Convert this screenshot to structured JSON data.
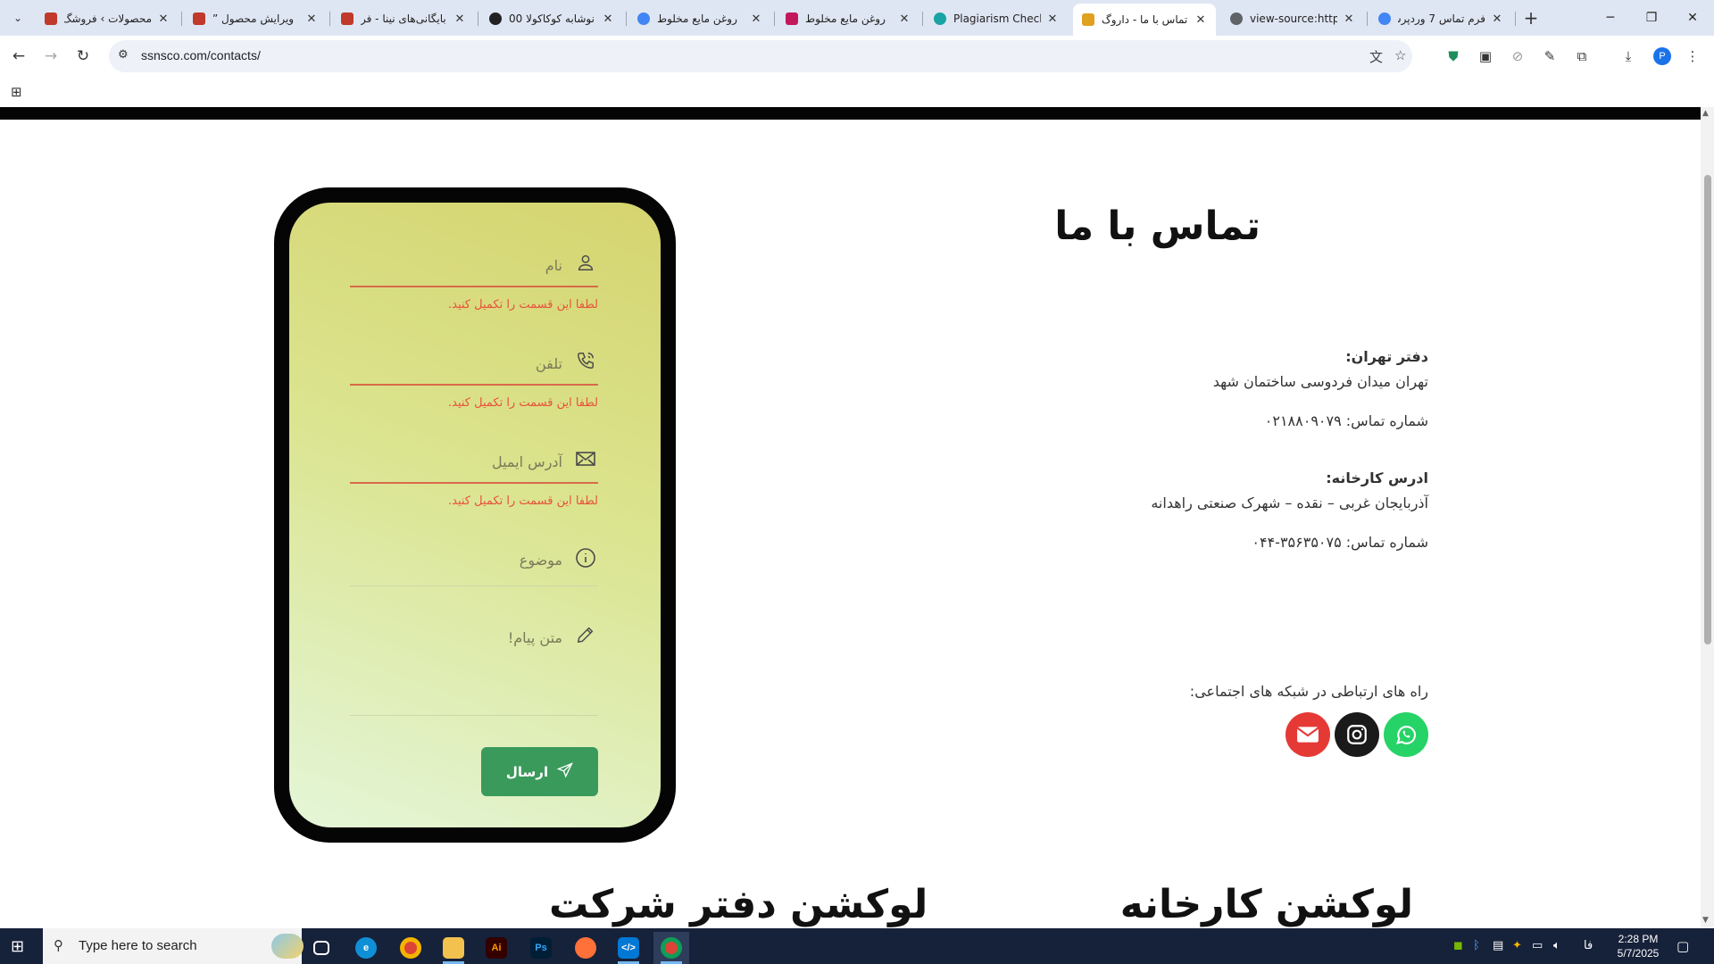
{
  "browser": {
    "tabs": [
      {
        "title": "محصولات › فروشگ",
        "favicon_color": "#c0392b",
        "active": false
      },
      {
        "title": "ویرایش محصول ”",
        "favicon_color": "#c0392b",
        "active": false
      },
      {
        "title": "بایگانی‌های نینا - فر",
        "favicon_color": "#c0392b",
        "active": false
      },
      {
        "title": "نوشابه کوکاکولا 00",
        "favicon_color": "#222222",
        "active": false
      },
      {
        "title": "روغن مایع مخلوط",
        "favicon_color": "#4285f4",
        "active": false
      },
      {
        "title": "روغن مایع مخلوط",
        "favicon_color": "#c2185b",
        "active": false
      },
      {
        "title": "Plagiarism Checke",
        "favicon_color": "#1aa3a3",
        "active": false
      },
      {
        "title": "تماس با ما - داروگ",
        "favicon_color": "#e0a020",
        "active": true
      },
      {
        "title": "view-source:https",
        "favicon_color": "#5f6368",
        "active": false
      },
      {
        "title": "فرم تماس 7 وردپرس",
        "favicon_color": "#4285f4",
        "active": false
      }
    ],
    "url": "ssnsco.com/contacts/",
    "profile_initial": "P"
  },
  "page": {
    "title": "تماس با ما",
    "form": {
      "fields": [
        {
          "placeholder": "نام",
          "icon": "user-icon",
          "error": "لطفا این قسمت را تکمیل کنید."
        },
        {
          "placeholder": "تلفن",
          "icon": "phone-icon",
          "error": "لطفا این قسمت را تکمیل کنید."
        },
        {
          "placeholder": "آدرس ایمیل",
          "icon": "envelope-icon",
          "error": "لطفا این قسمت را تکمیل کنید."
        },
        {
          "placeholder": "موضوع",
          "icon": "info-icon",
          "error": ""
        },
        {
          "placeholder": "متن پیام!",
          "icon": "pencil-icon",
          "error": ""
        }
      ],
      "submit_label": "ارسال"
    },
    "offices": [
      {
        "label": "دفتر تهران:",
        "address": "تهران میدان فردوسی ساختمان شهد",
        "phone": "شماره تماس: ۰۲۱۸۸۰۹۰۷۹"
      },
      {
        "label": "ادرس کارخانه:",
        "address": "آذربایجان غربی – نقده – شهرک صنعتی راهدانه",
        "phone": "شماره تماس: ۳۵۶۳۵۰۷۵-۰۴۴"
      }
    ],
    "social": {
      "caption": "راه های ارتباطی در شبکه های اجتماعی:",
      "items": [
        {
          "icon": "whatsapp-icon",
          "color": "#25d366"
        },
        {
          "icon": "instagram-icon",
          "color": "#1a1a1a"
        },
        {
          "icon": "email-icon",
          "color": "#e53935"
        }
      ]
    },
    "sections": {
      "factory_location": "لوکشن کارخانه",
      "office_location": "لوکشن دفتر شرکت"
    }
  },
  "taskbar": {
    "search_placeholder": "Type here to search",
    "time": "2:28 PM",
    "date": "5/7/2025",
    "language": "فا"
  }
}
